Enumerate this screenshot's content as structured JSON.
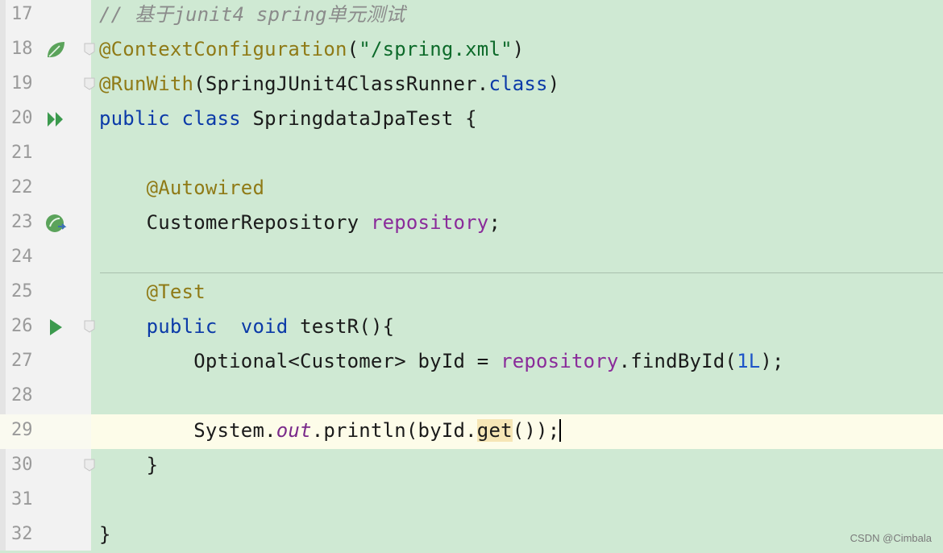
{
  "editor": {
    "current_line": 29,
    "lines": [
      {
        "num": "17",
        "tokens": [
          {
            "t": "// 基于junit4 spring单元测试",
            "c": "cmt"
          }
        ]
      },
      {
        "num": "18",
        "tokens": [
          {
            "t": "@ContextConfiguration",
            "c": "ann"
          },
          {
            "t": "(",
            "c": ""
          },
          {
            "t": "\"/spring.xml\"",
            "c": "str"
          },
          {
            "t": ")",
            "c": ""
          }
        ]
      },
      {
        "num": "19",
        "tokens": [
          {
            "t": "@RunWith",
            "c": "ann"
          },
          {
            "t": "(SpringJUnit4ClassRunner.",
            "c": ""
          },
          {
            "t": "class",
            "c": "kw"
          },
          {
            "t": ")",
            "c": ""
          }
        ]
      },
      {
        "num": "20",
        "tokens": [
          {
            "t": "public class ",
            "c": "kw"
          },
          {
            "t": "SpringdataJpaTest {",
            "c": ""
          }
        ]
      },
      {
        "num": "21",
        "tokens": []
      },
      {
        "num": "22",
        "tokens": [
          {
            "t": "    ",
            "c": ""
          },
          {
            "t": "@Autowired",
            "c": "ann"
          }
        ]
      },
      {
        "num": "23",
        "tokens": [
          {
            "t": "    CustomerRepository ",
            "c": ""
          },
          {
            "t": "repository",
            "c": "fld"
          },
          {
            "t": ";",
            "c": ""
          }
        ]
      },
      {
        "num": "24",
        "tokens": []
      },
      {
        "num": "25",
        "tokens": [
          {
            "t": "    ",
            "c": ""
          },
          {
            "t": "@Test",
            "c": "ann"
          }
        ]
      },
      {
        "num": "26",
        "tokens": [
          {
            "t": "    ",
            "c": ""
          },
          {
            "t": "public  void ",
            "c": "kw"
          },
          {
            "t": "testR",
            "c": ""
          },
          {
            "t": "(){",
            "c": ""
          }
        ]
      },
      {
        "num": "27",
        "tokens": [
          {
            "t": "        Optional<Customer> byId = ",
            "c": ""
          },
          {
            "t": "repository",
            "c": "fld"
          },
          {
            "t": ".findById(",
            "c": ""
          },
          {
            "t": "1L",
            "c": "num"
          },
          {
            "t": ");",
            "c": ""
          }
        ]
      },
      {
        "num": "28",
        "tokens": []
      },
      {
        "num": "29",
        "tokens": [
          {
            "t": "        System.",
            "c": ""
          },
          {
            "t": "out",
            "c": "ital"
          },
          {
            "t": ".println(byId.",
            "c": ""
          },
          {
            "t": "get",
            "c": "hl"
          },
          {
            "t": "());",
            "c": ""
          }
        ]
      },
      {
        "num": "30",
        "tokens": [
          {
            "t": "    }",
            "c": ""
          }
        ]
      },
      {
        "num": "31",
        "tokens": []
      },
      {
        "num": "32",
        "tokens": [
          {
            "t": "}",
            "c": ""
          }
        ]
      }
    ],
    "gutter_icons": [
      {
        "line": "18",
        "name": "spring-leaf-icon"
      },
      {
        "line": "20",
        "name": "run-class-icon"
      },
      {
        "line": "23",
        "name": "spring-bean-navigate-icon"
      },
      {
        "line": "26",
        "name": "run-test-icon"
      }
    ],
    "colors": {
      "background": "#cfe9d3",
      "gutter": "#f2f2f2",
      "current_line": "#fdfce9",
      "keyword": "#0b3aa8",
      "annotation": "#8f7a16",
      "string": "#0d6a2a",
      "field": "#8a2b9a",
      "comment": "#8b8b8b"
    }
  },
  "watermark": "CSDN @Cimbala"
}
